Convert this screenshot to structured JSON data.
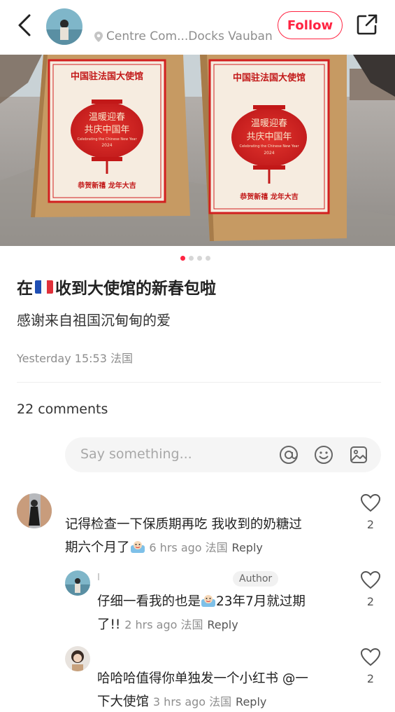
{
  "header": {
    "location": "Centre Com...Docks Vauban",
    "follow_label": "Follow"
  },
  "photo": {
    "bag_title": "中国驻法国大使馆",
    "lantern_line1": "温暖迎春",
    "lantern_line2": "共庆中国年",
    "lantern_en": "Celebrating the Chinese New Year",
    "lantern_year": "2024",
    "bag_footer": "恭贺新禧 龙年大吉",
    "page_count": 4,
    "active_page": 1
  },
  "post": {
    "title_before": "在",
    "title_after": "收到大使馆的新春包啦",
    "body": "感谢来自祖国沉甸甸的爱",
    "meta": "Yesterday 15:53 法国"
  },
  "comments": {
    "count_label": "22 comments",
    "input_placeholder": "Say something...",
    "items": [
      {
        "line1": "记得检查一下保质期再吃 我收到的奶糖过",
        "line2": "期六个月了",
        "meta": "6 hrs ago 法国",
        "reply": "Reply",
        "likes": "2"
      },
      {
        "badge": "Author",
        "line1": "仔细一看我的也是",
        "line1_after": "23年7月就过期",
        "line2": "了!!",
        "meta": "2 hrs ago 法国",
        "reply": "Reply",
        "likes": "2"
      },
      {
        "line1": "哈哈哈值得你单独发一个小红书 @一",
        "line2": "下大使馆",
        "meta": "3 hrs ago 法国",
        "reply": "Reply",
        "likes": "2"
      }
    ]
  },
  "colors": {
    "accent": "#ff2442",
    "bag_red": "#d21f1f",
    "kraft": "#c69a63"
  },
  "icons": [
    "back-icon",
    "location-pin-icon",
    "share-icon",
    "at-icon",
    "emoji-icon",
    "image-icon",
    "heart-icon"
  ]
}
